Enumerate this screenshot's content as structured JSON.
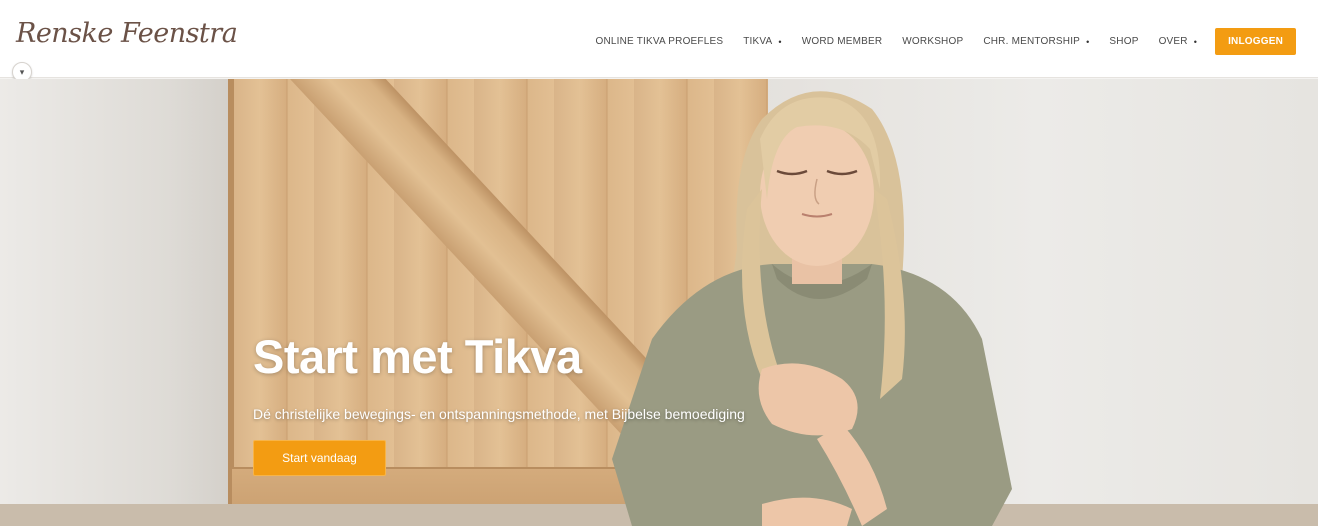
{
  "header": {
    "logo_text": "Renske Feenstra",
    "lang_toggle_icon": "chevron-down-icon",
    "nav": [
      {
        "label": "ONLINE TIKVA PROEFLES",
        "has_dropdown": false
      },
      {
        "label": "TIKVA",
        "has_dropdown": true
      },
      {
        "label": "WORD MEMBER",
        "has_dropdown": false
      },
      {
        "label": "WORKSHOP",
        "has_dropdown": false
      },
      {
        "label": "CHR. MENTORSHIP",
        "has_dropdown": true
      },
      {
        "label": "SHOP",
        "has_dropdown": false
      },
      {
        "label": "OVER",
        "has_dropdown": true
      }
    ],
    "login_label": "INLOGGEN"
  },
  "hero": {
    "title": "Start met Tikva",
    "subtitle": "Dé christelijke bewegings- en ontspanningsmethode, met Bijbelse bemoediging",
    "cta_label": "Start vandaag"
  },
  "colors": {
    "accent": "#f39c12",
    "logo": "#6b5247",
    "nav_text": "#4a4a4a"
  }
}
